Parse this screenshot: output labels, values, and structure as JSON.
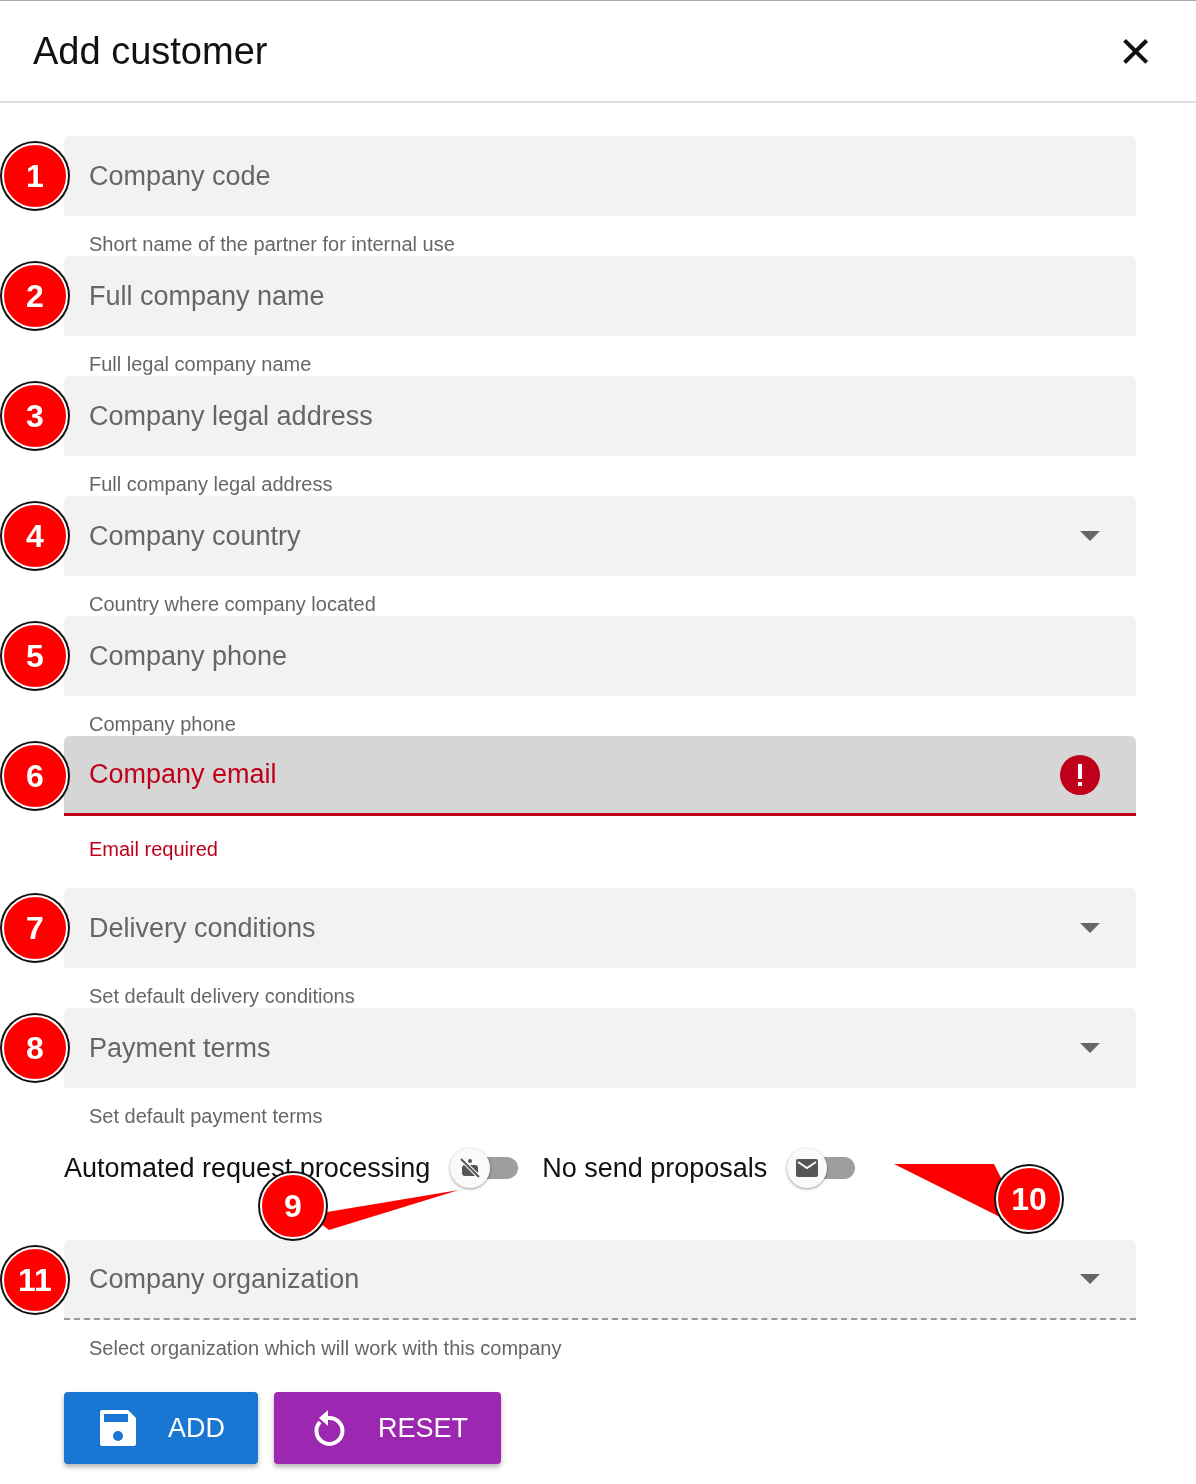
{
  "dialog": {
    "title": "Add customer",
    "close": "×"
  },
  "fields": [
    {
      "callout": "1",
      "kind": "text",
      "label": "Company code",
      "helper": "Short name of the partner for internal use",
      "error": false,
      "disabled": false
    },
    {
      "callout": "2",
      "kind": "text",
      "label": "Full company name",
      "helper": "Full legal company name",
      "error": false,
      "disabled": false
    },
    {
      "callout": "3",
      "kind": "text",
      "label": "Company legal address",
      "helper": "Full company legal address",
      "error": false,
      "disabled": false
    },
    {
      "callout": "4",
      "kind": "select",
      "label": "Company country",
      "helper": "Country where company located",
      "error": false,
      "disabled": false
    },
    {
      "callout": "5",
      "kind": "text",
      "label": "Company phone",
      "helper": "Company phone",
      "error": false,
      "disabled": false
    },
    {
      "callout": "6",
      "kind": "text",
      "label": "Company email",
      "helper": "Email required",
      "error": true,
      "disabled": false
    },
    {
      "callout": "7",
      "kind": "select",
      "label": "Delivery conditions",
      "helper": "Set default delivery conditions",
      "error": false,
      "disabled": false
    },
    {
      "callout": "8",
      "kind": "select",
      "label": "Payment terms",
      "helper": "Set default payment terms",
      "error": false,
      "disabled": false
    }
  ],
  "toggles": [
    {
      "label": "Automated request processing",
      "kind": "automation",
      "on": false,
      "callout": "9"
    },
    {
      "label": "No send proposals",
      "kind": "proposals",
      "on": false,
      "callout": "10"
    }
  ],
  "last_field": {
    "callout": "11",
    "kind": "select",
    "label": "Company organization",
    "helper": "Select organization which will work with this company",
    "error": false,
    "disabled": true
  },
  "buttons": [
    {
      "label": "ADD",
      "kind": "save",
      "color": "#1976d2"
    },
    {
      "label": "RESET",
      "kind": "reset",
      "color": "#9c27b0"
    }
  ]
}
